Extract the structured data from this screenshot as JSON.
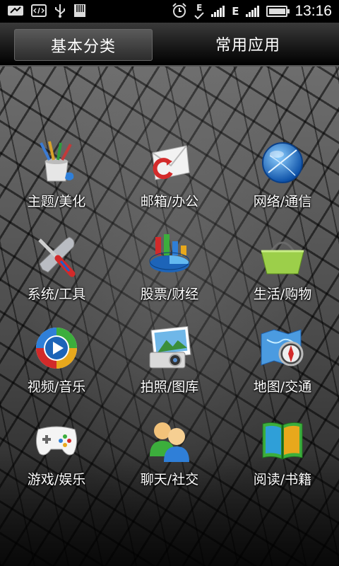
{
  "status_bar": {
    "left_icons": [
      "notification-icon",
      "code-icon",
      "usb-icon",
      "sd-card-icon"
    ],
    "right_icons": [
      "alarm-icon",
      "edge-data-icon",
      "signal-icon-1",
      "edge-icon-2",
      "signal-icon-2",
      "battery-icon"
    ],
    "edge_label_1": "E",
    "edge_label_2": "E",
    "time": "13:16",
    "battery_level": 0.85
  },
  "tabs": [
    {
      "label": "基本分类",
      "active": true
    },
    {
      "label": "常用应用",
      "active": false
    }
  ],
  "categories": [
    {
      "label": "主题/美化",
      "icon": "paintbrush-cup-icon"
    },
    {
      "label": "邮箱/办公",
      "icon": "mail-envelope-icon"
    },
    {
      "label": "网络/通信",
      "icon": "globe-network-icon"
    },
    {
      "label": "系统/工具",
      "icon": "screwdriver-wrench-icon"
    },
    {
      "label": "股票/财经",
      "icon": "pie-bar-chart-icon"
    },
    {
      "label": "生活/购物",
      "icon": "shopping-basket-icon"
    },
    {
      "label": "视频/音乐",
      "icon": "media-play-icon"
    },
    {
      "label": "拍照/图库",
      "icon": "camera-photo-icon"
    },
    {
      "label": "地图/交通",
      "icon": "map-compass-icon"
    },
    {
      "label": "游戏/娱乐",
      "icon": "gamepad-icon"
    },
    {
      "label": "聊天/社交",
      "icon": "chat-users-icon"
    },
    {
      "label": "阅读/书籍",
      "icon": "book-icon"
    }
  ],
  "colors": {
    "tab_active_bg": "#4a4a4a",
    "statusbar_bg": "#000000"
  }
}
